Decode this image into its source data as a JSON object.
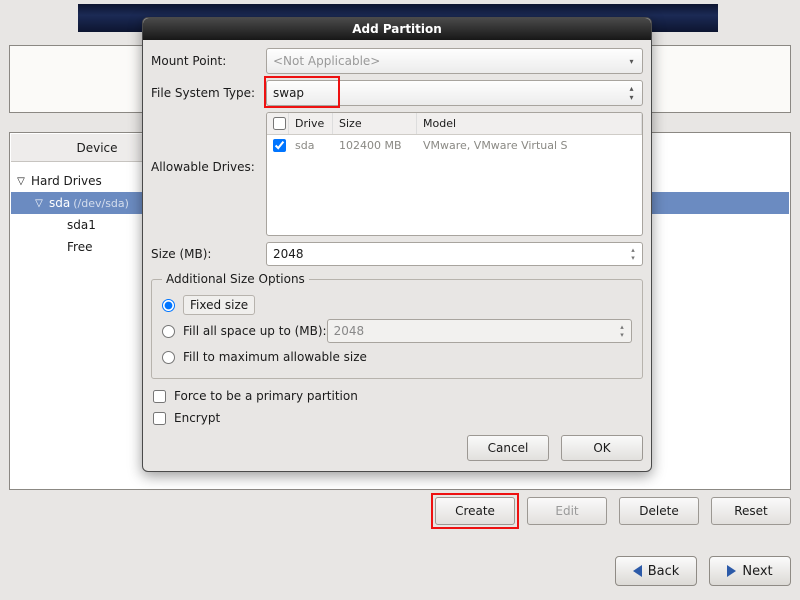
{
  "device_tree": {
    "header": "Device",
    "root_label": "Hard Drives",
    "disk_label": "sda",
    "disk_path": "(/dev/sda)",
    "part1": "sda1",
    "free": "Free"
  },
  "dialog": {
    "title": "Add Partition",
    "mount_point_label": "Mount Point:",
    "mount_point_value": "<Not Applicable>",
    "fstype_label": "File System Type:",
    "fstype_value": "swap",
    "allowable_label": "Allowable Drives:",
    "drives": {
      "col_drive": "Drive",
      "col_size": "Size",
      "col_model": "Model",
      "row": {
        "drive": "sda",
        "size": "102400 MB",
        "model": "VMware, VMware Virtual S"
      }
    },
    "size_label": "Size (MB):",
    "size_value": "2048",
    "addl_legend": "Additional Size Options",
    "opt_fixed": "Fixed size",
    "opt_fillupto": "Fill all space up to (MB):",
    "opt_fillupto_value": "2048",
    "opt_fillmax": "Fill to maximum allowable size",
    "force_primary": "Force to be a primary partition",
    "encrypt": "Encrypt",
    "cancel": "Cancel",
    "ok": "OK"
  },
  "actions": {
    "create": "Create",
    "edit": "Edit",
    "delete": "Delete",
    "reset": "Reset"
  },
  "nav": {
    "back": "Back",
    "next": "Next"
  }
}
